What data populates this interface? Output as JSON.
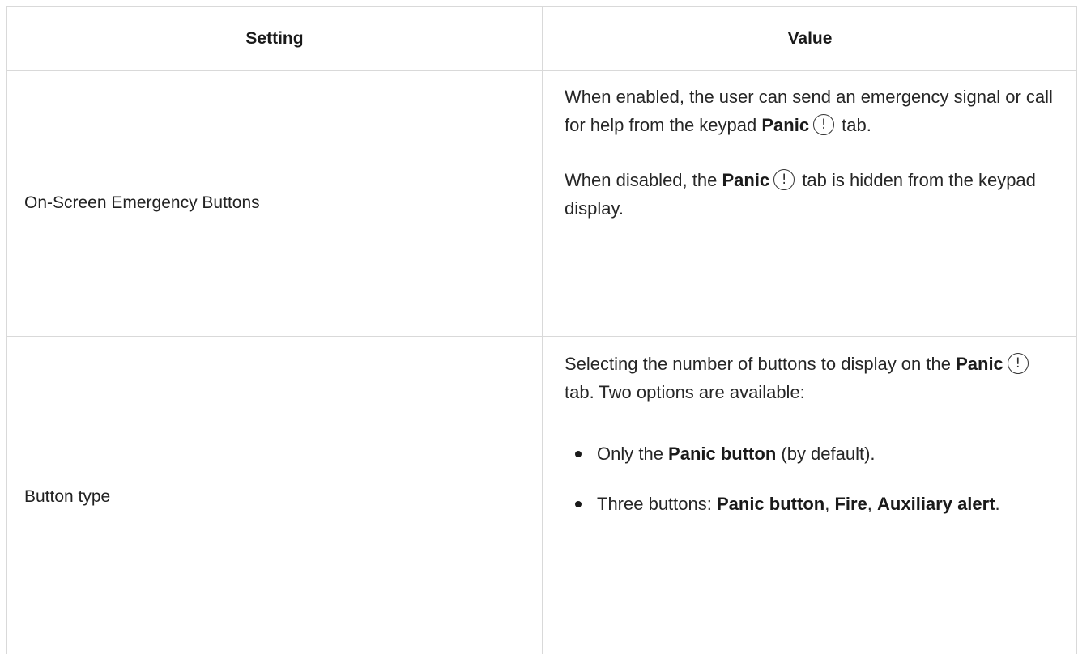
{
  "table": {
    "headers": {
      "setting": "Setting",
      "value": "Value"
    },
    "rows": [
      {
        "setting": "On-Screen Emergency Buttons",
        "value": {
          "p1": {
            "before": "When enabled, the user can send an emergency signal or call for help from the keypad ",
            "bold": "Panic",
            "after": " tab."
          },
          "p2": {
            "before": "When disabled, the ",
            "bold": "Panic",
            "after": " tab is hidden from the keypad display."
          }
        }
      },
      {
        "setting": "Button type",
        "value": {
          "intro": {
            "bold": "Panic",
            "before": "Selecting the number of buttons to display on the ",
            "after": " tab. Two options are available:"
          },
          "option1": {
            "before": "Only the ",
            "bold": "Panic button",
            "after": " (by default)."
          },
          "option2": {
            "before": "Three buttons: ",
            "bold1": "Panic button",
            "sep1": ", ",
            "bold2": "Fire",
            "sep2": ", ",
            "bold3": "Auxiliary alert",
            "after": "."
          }
        }
      }
    ]
  },
  "icons": {
    "panic_tab_icon": "exclamation-circle-icon",
    "panic_tab_glyph": "!"
  }
}
